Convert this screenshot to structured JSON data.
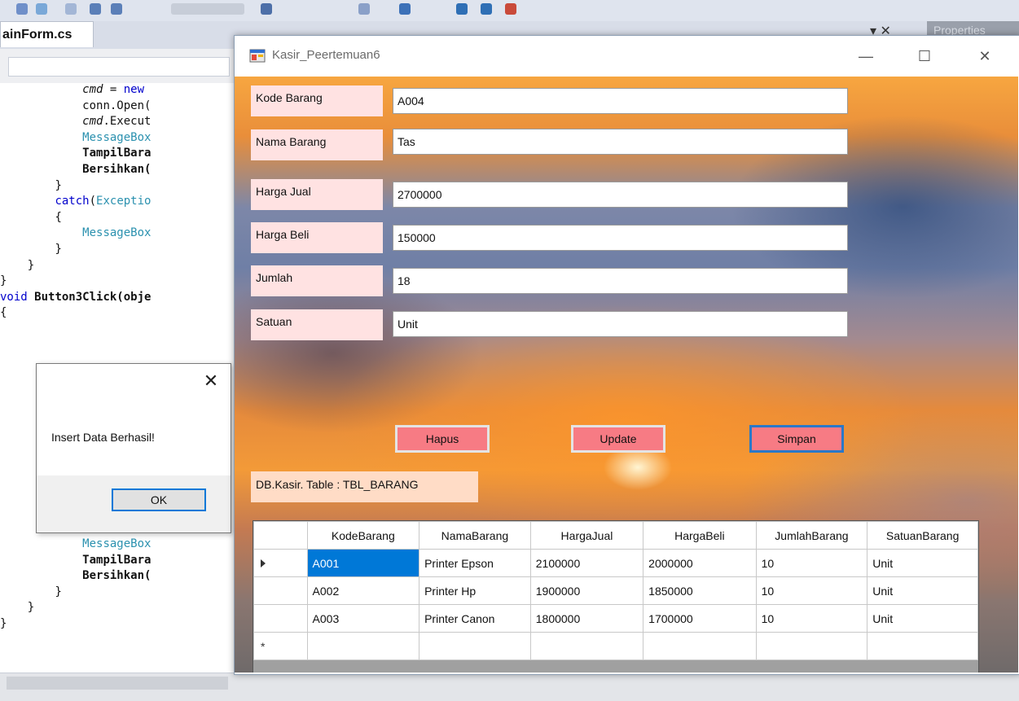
{
  "ide": {
    "file_tab": "ainForm.cs",
    "props_tab": "Properties",
    "tab_controls": "▾ ✕",
    "code": [
      {
        "indent": "            ",
        "parts": [
          {
            "t": "cmd",
            "c": "it"
          },
          {
            "t": " = "
          },
          {
            "t": "new",
            "c": "kw"
          }
        ]
      },
      {
        "indent": "            ",
        "parts": [
          {
            "t": "conn.Open("
          }
        ]
      },
      {
        "indent": "            ",
        "parts": [
          {
            "t": "cmd",
            "c": "it"
          },
          {
            "t": ".Execut"
          }
        ]
      },
      {
        "indent": "            ",
        "parts": [
          {
            "t": "MessageBox",
            "c": "ty"
          }
        ]
      },
      {
        "indent": "            ",
        "parts": [
          {
            "t": "TampilBara",
            "c": "bold"
          }
        ]
      },
      {
        "indent": "            ",
        "parts": [
          {
            "t": "Bersihkan(",
            "c": "bold"
          }
        ]
      },
      {
        "indent": "        ",
        "parts": [
          {
            "t": "}"
          }
        ]
      },
      {
        "indent": "        ",
        "parts": [
          {
            "t": "catch",
            "c": "kw"
          },
          {
            "t": "("
          },
          {
            "t": "Exceptio",
            "c": "ty"
          }
        ]
      },
      {
        "indent": "        ",
        "parts": [
          {
            "t": "{"
          }
        ]
      },
      {
        "indent": "            ",
        "parts": [
          {
            "t": "MessageBox",
            "c": "ty"
          }
        ]
      },
      {
        "indent": "        ",
        "parts": [
          {
            "t": "}"
          }
        ]
      },
      {
        "indent": "    ",
        "parts": [
          {
            "t": "}"
          }
        ]
      },
      {
        "indent": "",
        "parts": [
          {
            "t": "}"
          }
        ]
      },
      {
        "indent": "",
        "parts": [
          {
            "t": "void",
            "c": "kw"
          },
          {
            "t": " "
          },
          {
            "t": "Button3Click(obje",
            "c": "bold"
          }
        ]
      },
      {
        "indent": "",
        "parts": [
          {
            "t": "{"
          }
        ]
      }
    ],
    "code_bottom": [
      {
        "indent": "            ",
        "parts": [
          {
            "t": "MessageBox",
            "c": "ty"
          }
        ]
      },
      {
        "indent": "            ",
        "parts": [
          {
            "t": "TampilBara",
            "c": "bold"
          }
        ]
      },
      {
        "indent": "            ",
        "parts": [
          {
            "t": "Bersihkan(",
            "c": "bold"
          }
        ]
      },
      {
        "indent": "        ",
        "parts": [
          {
            "t": "}"
          }
        ]
      },
      {
        "indent": "    ",
        "parts": [
          {
            "t": "}"
          }
        ]
      },
      {
        "indent": "",
        "parts": [
          {
            "t": "}"
          }
        ]
      }
    ]
  },
  "messagebox": {
    "text": "Insert Data Berhasil!",
    "ok_label": "OK",
    "close_glyph": "✕"
  },
  "window": {
    "title": "Kasir_Peertemuan6",
    "min_glyph": "—",
    "max_glyph": "☐",
    "close_glyph": "✕"
  },
  "form": {
    "fields": [
      {
        "label": "Kode Barang",
        "value": "A004"
      },
      {
        "label": "Nama Barang",
        "value": "Tas"
      },
      {
        "label": "Harga Jual",
        "value": "2700000"
      },
      {
        "label": "Harga Beli",
        "value": "150000"
      },
      {
        "label": "Jumlah",
        "value": "18"
      },
      {
        "label": "Satuan",
        "value": "Unit"
      }
    ],
    "buttons": {
      "hapus": "Hapus",
      "update": "Update",
      "simpan": "Simpan"
    },
    "db_label": "DB.Kasir. Table : TBL_BARANG"
  },
  "grid": {
    "columns": [
      "KodeBarang",
      "NamaBarang",
      "HargaJual",
      "HargaBeli",
      "JumlahBarang",
      "SatuanBarang"
    ],
    "rows": [
      [
        "A001",
        "Printer Epson",
        "2100000",
        "2000000",
        "10",
        "Unit"
      ],
      [
        "A002",
        "Printer Hp",
        "1900000",
        "1850000",
        "10",
        "Unit"
      ],
      [
        "A003",
        "Printer Canon",
        "1800000",
        "1700000",
        "10",
        "Unit"
      ]
    ],
    "new_row_glyph": "*"
  }
}
